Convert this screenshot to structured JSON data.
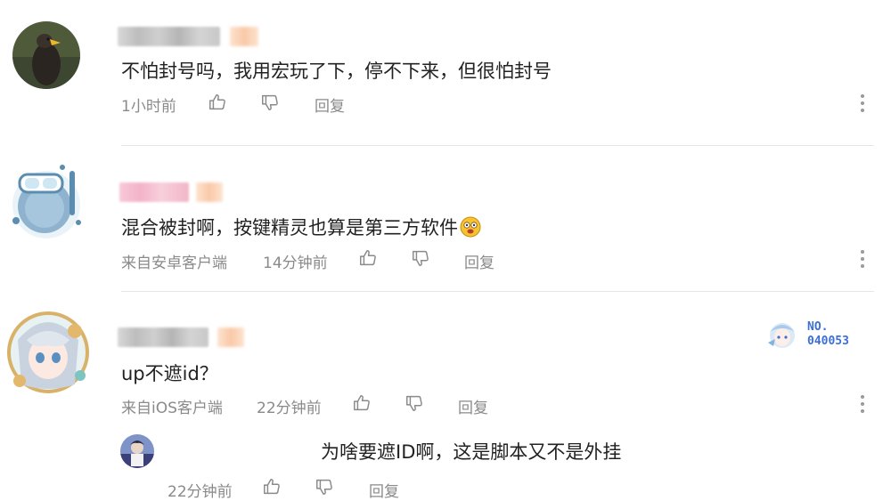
{
  "comments": [
    {
      "text": "不怕封号吗，我用宏玩了下，停不下来，但很怕封号",
      "time": "1小时前",
      "reply_label": "回复",
      "icons": {
        "like": "thumbs-up-icon",
        "dislike": "thumbs-down-icon",
        "more": "more-vertical-icon"
      }
    },
    {
      "text": "混合被封啊，按键精灵也算是第三方软件",
      "emoji": "scared-face-emoji",
      "source": "来自安卓客户端",
      "time": "14分钟前",
      "reply_label": "回复"
    },
    {
      "text": "up不遮id？",
      "source": "来自iOS客户端",
      "time": "22分钟前",
      "reply_label": "回复",
      "badge": {
        "line1": "NO.",
        "line2": "040053"
      }
    }
  ],
  "reply": {
    "text": "为啥要遮ID啊，这是脚本又不是外挂",
    "time": "22分钟前",
    "reply_label": "回复"
  },
  "colors": {
    "text": "#222222",
    "meta": "#8a8a8a",
    "divider": "#e6e6e6",
    "badge": "#3a6fd8"
  }
}
